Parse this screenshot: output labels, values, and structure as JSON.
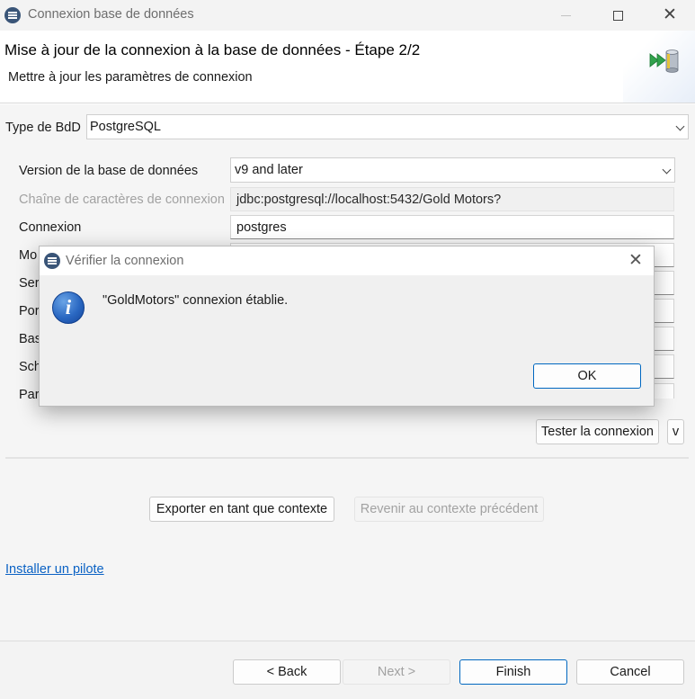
{
  "window": {
    "title": "Connexion base de données",
    "controls": {
      "minimize": "",
      "maximize": "",
      "close": "✕"
    }
  },
  "header": {
    "title": "Mise à jour de la connexion à la base de données - Étape 2/2",
    "subtitle": "Mettre à jour les paramètres de connexion",
    "icon": "wizard-forward-database-icon"
  },
  "form": {
    "db_type": {
      "label": "Type de BdD",
      "value": "PostgreSQL"
    },
    "db_version": {
      "label": "Version de la base de données",
      "value": "v9 and later"
    },
    "conn_string": {
      "label": "Chaîne de caractères de connexion",
      "value": "jdbc:postgresql://localhost:5432/Gold Motors?"
    },
    "login": {
      "label": "Connexion",
      "value": "postgres"
    },
    "password_label_partial": "Mo",
    "server_label_partial": "Ser",
    "port_label_partial": "Por",
    "database_label_partial": "Bas",
    "schema_label_partial": "Sch",
    "params_label_partial": "Para"
  },
  "buttons": {
    "test_connection": "Tester la connexion",
    "v_button": "v",
    "export_context": "Exporter en tant que contexte",
    "revert_context": "Revenir au contexte précédent",
    "back": "< Back",
    "next": "Next >",
    "finish": "Finish",
    "cancel": "Cancel"
  },
  "links": {
    "install_driver": "Installer un pilote"
  },
  "dialog": {
    "title": "Vérifier la connexion",
    "close": "✕",
    "message": "\"GoldMotors\" connexion établie.",
    "ok": "OK",
    "icon": "info-icon"
  }
}
